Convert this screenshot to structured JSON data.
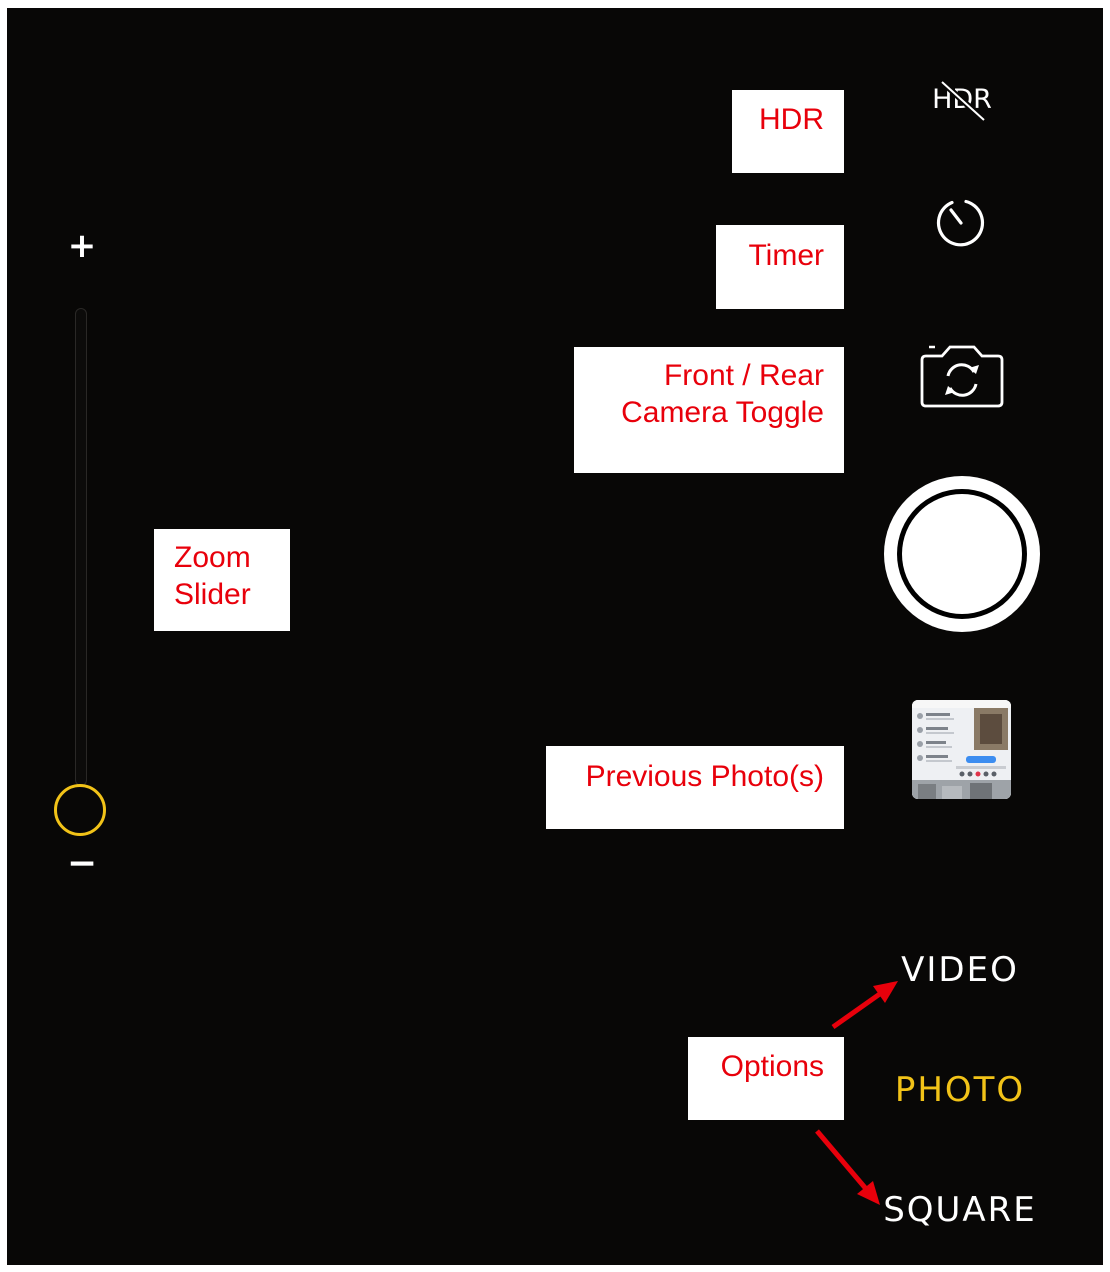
{
  "colors": {
    "background": "#080706",
    "accent_yellow": "#f2c318",
    "annotation_red": "#e8000b",
    "annotation_bg": "#ffffff",
    "icon_white": "#ffffff"
  },
  "zoom": {
    "plus_symbol": "+",
    "minus_symbol": "−",
    "level": 0
  },
  "controls": {
    "hdr_label": "HDR",
    "hdr_icon": "hdr-off-icon",
    "timer_icon": "timer-icon",
    "camera_toggle_icon": "camera-flip-icon",
    "shutter_icon": "shutter-button",
    "thumbnail_icon": "photo-thumbnail"
  },
  "modes": [
    {
      "label": "VIDEO",
      "selected": false
    },
    {
      "label": "PHOTO",
      "selected": true
    },
    {
      "label": "SQUARE",
      "selected": false
    }
  ],
  "annotations": {
    "hdr": [
      "HDR"
    ],
    "timer": [
      "Timer"
    ],
    "camera_toggle": [
      "Front / Rear",
      "Camera Toggle"
    ],
    "zoom_slider": [
      "Zoom",
      "Slider"
    ],
    "previous_photos": [
      "Previous Photo(s)"
    ],
    "options": [
      "Options"
    ]
  }
}
